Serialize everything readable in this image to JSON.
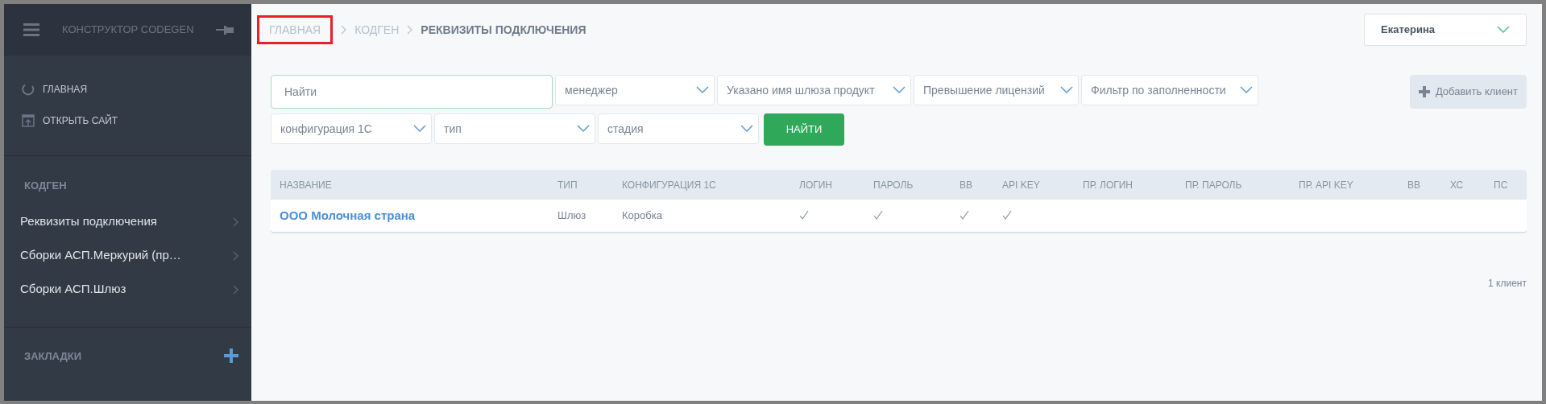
{
  "sidebar": {
    "title": "КОНСТРУКТОР CODEGEN",
    "nav": [
      {
        "label": "ГЛАВНАЯ",
        "kind": "home"
      },
      {
        "label": "ОТКРЫТЬ САЙТ",
        "kind": "site"
      }
    ],
    "section": "КОДГЕН",
    "items": [
      {
        "label": "Реквизиты подключения"
      },
      {
        "label": "Сборки АСП.Меркурий (пр…"
      },
      {
        "label": "Сборки АСП.Шлюз"
      }
    ],
    "bookmarks": "ЗАКЛАДКИ"
  },
  "breadcrumbs": [
    {
      "label": "ГЛАВНАЯ",
      "current": false,
      "highlighted": true
    },
    {
      "label": "КОДГЕН",
      "current": false,
      "highlighted": false
    },
    {
      "label": "РЕКВИЗИТЫ ПОДКЛЮЧЕНИЯ",
      "current": true,
      "highlighted": false
    }
  ],
  "user": "Екатерина",
  "search": {
    "placeholder": "Найти"
  },
  "filters_row1": [
    "менеджер",
    "Указано имя шлюза продукт",
    "Превышение лицензий",
    "Фильтр по заполненности"
  ],
  "filters_row2": [
    "конфигурация 1С",
    "тип",
    "стадия"
  ],
  "find_button": "НАЙТИ",
  "add_button": "Добавить клиент",
  "table": {
    "columns": [
      "НАЗВАНИЕ",
      "ТИП",
      "КОНФИГУРАЦИЯ 1С",
      "ЛОГИН",
      "ПАРОЛЬ",
      "ВВ",
      "API KEY",
      "ПР. ЛОГИН",
      "ПР. ПАРОЛЬ",
      "ПР. API KEY",
      "ВВ",
      "ХС",
      "ПС"
    ],
    "rows": [
      {
        "name": "ООО Молочная страна",
        "type": "Шлюз",
        "config": "Коробка",
        "checks": [
          true,
          true,
          true,
          true,
          false,
          false,
          false,
          false,
          false,
          false
        ]
      }
    ]
  },
  "count": "1 клиент"
}
